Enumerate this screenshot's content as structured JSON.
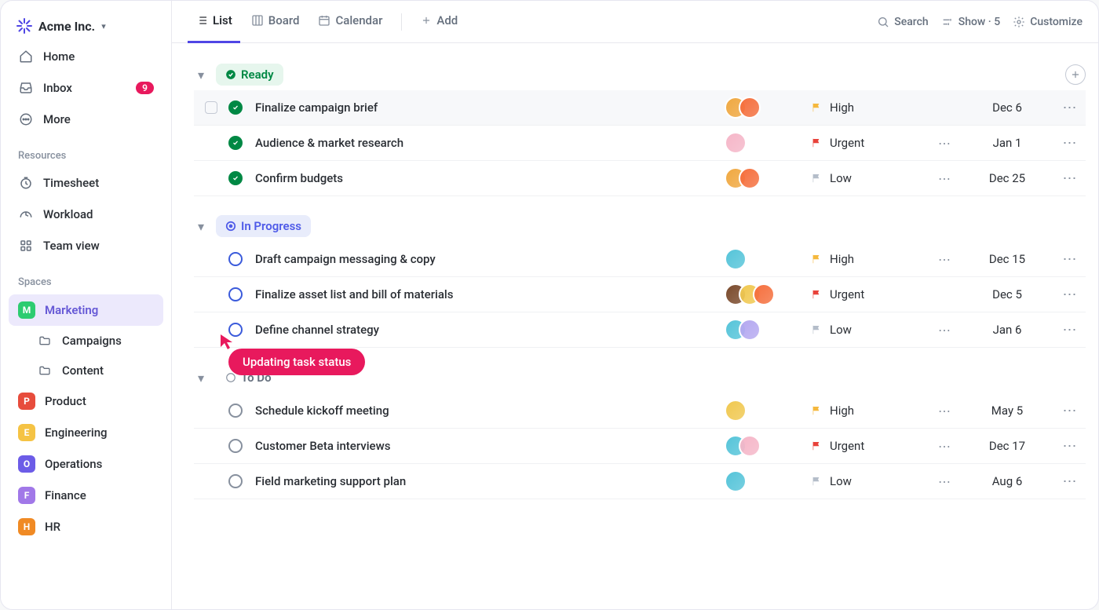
{
  "workspace": {
    "name": "Acme Inc."
  },
  "nav": {
    "home": "Home",
    "inbox": "Inbox",
    "inbox_badge": "9",
    "more": "More"
  },
  "resources": {
    "label": "Resources",
    "timesheet": "Timesheet",
    "workload": "Workload",
    "teamview": "Team view"
  },
  "spaces": {
    "label": "Spaces",
    "items": [
      {
        "letter": "M",
        "name": "Marketing",
        "color": "#2dcc70",
        "active": true,
        "children": [
          "Campaigns",
          "Content"
        ]
      },
      {
        "letter": "P",
        "name": "Product",
        "color": "#e74c3c"
      },
      {
        "letter": "E",
        "name": "Engineering",
        "color": "#f5c344"
      },
      {
        "letter": "O",
        "name": "Operations",
        "color": "#6c5ce7"
      },
      {
        "letter": "F",
        "name": "Finance",
        "color": "#a178e8"
      },
      {
        "letter": "H",
        "name": "HR",
        "color": "#f08a24"
      }
    ]
  },
  "views": {
    "list": "List",
    "board": "Board",
    "calendar": "Calendar",
    "add": "Add"
  },
  "toolbar": {
    "search": "Search",
    "show": "Show",
    "show_count": "5",
    "customize": "Customize"
  },
  "groups": [
    {
      "id": "ready",
      "label": "Ready",
      "style": "ready",
      "show_add": true,
      "tasks": [
        {
          "hovered": true,
          "status": "done",
          "title": "Finalize campaign brief",
          "avatars": [
            "#f0a840",
            "#f56f3d"
          ],
          "priority": "High",
          "flag": "#f5b83d",
          "subtasks": false,
          "date": "Dec 6"
        },
        {
          "status": "done",
          "title": "Audience & market research",
          "avatars": [
            "#f5b6c8"
          ],
          "priority": "Urgent",
          "flag": "#e8423a",
          "subtasks": true,
          "date": "Jan 1"
        },
        {
          "status": "done",
          "title": "Confirm budgets",
          "avatars": [
            "#f0a840",
            "#f56f3d"
          ],
          "priority": "Low",
          "flag": "#b4bdc9",
          "subtasks": true,
          "date": "Dec 25"
        }
      ]
    },
    {
      "id": "inprogress",
      "label": "In Progress",
      "style": "progress",
      "tasks": [
        {
          "status": "ring-blue",
          "title": "Draft campaign messaging & copy",
          "avatars": [
            "#55c4d9"
          ],
          "priority": "High",
          "flag": "#f5b83d",
          "subtasks": true,
          "date": "Dec 15"
        },
        {
          "status": "ring-blue",
          "title": "Finalize asset list and bill of materials",
          "avatars": [
            "#7a4a2c",
            "#f0c850",
            "#f56f3d"
          ],
          "priority": "Urgent",
          "flag": "#e8423a",
          "subtasks": false,
          "date": "Dec 5"
        },
        {
          "status": "ring-blue",
          "title": "Define channel strategy",
          "avatars": [
            "#55c4d9",
            "#b4a8f0"
          ],
          "priority": "Low",
          "flag": "#b4bdc9",
          "subtasks": true,
          "date": "Jan 6",
          "cursor": true
        }
      ]
    },
    {
      "id": "todo",
      "label": "To Do",
      "style": "todo",
      "tasks": [
        {
          "status": "ring-gray",
          "title": "Schedule kickoff meeting",
          "avatars": [
            "#f0c850"
          ],
          "priority": "High",
          "flag": "#f5b83d",
          "subtasks": true,
          "date": "May 5"
        },
        {
          "status": "ring-gray",
          "title": "Customer Beta interviews",
          "avatars": [
            "#55c4d9",
            "#f5b6c8"
          ],
          "priority": "Urgent",
          "flag": "#e8423a",
          "subtasks": true,
          "date": "Dec 17"
        },
        {
          "status": "ring-gray",
          "title": "Field marketing support plan",
          "avatars": [
            "#55c4d9"
          ],
          "priority": "Low",
          "flag": "#b4bdc9",
          "subtasks": true,
          "date": "Aug 6"
        }
      ]
    }
  ],
  "tooltip": {
    "text": "Updating task status"
  }
}
